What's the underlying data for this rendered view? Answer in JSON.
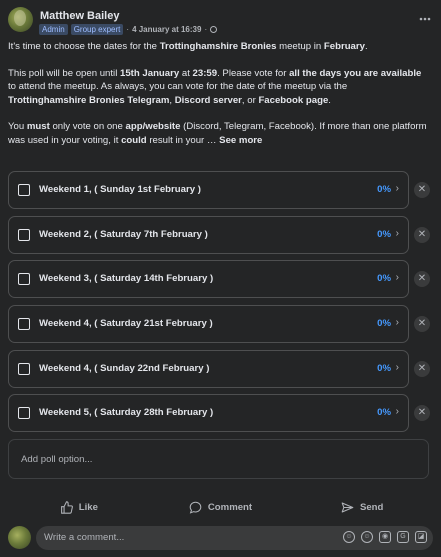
{
  "post": {
    "author": "Matthew Bailey",
    "badges": [
      "Admin",
      "Group expert"
    ],
    "separator": "·",
    "date": "4 January at 16:39",
    "more_icon": "more-horizontal-icon",
    "privacy_icon": "globe-icon"
  },
  "body": {
    "p1": [
      {
        "t": "It's time to choose the dates for the "
      },
      {
        "t": "Trottinghamshire Bronies",
        "b": true
      },
      {
        "t": " meetup in "
      },
      {
        "t": "February",
        "b": true
      },
      {
        "t": "."
      }
    ],
    "p2": [
      {
        "t": "This poll will be open until "
      },
      {
        "t": "15th January",
        "b": true
      },
      {
        "t": " at "
      },
      {
        "t": "23:59",
        "b": true
      },
      {
        "t": ". Please vote for "
      },
      {
        "t": "all the days you are available",
        "b": true
      },
      {
        "t": " to attend the meetup. As always, you can vote for the date of the meetup via the "
      },
      {
        "t": "Trottinghamshire Bronies Telegram",
        "b": true
      },
      {
        "t": ", "
      },
      {
        "t": "Discord server",
        "b": true
      },
      {
        "t": ", or "
      },
      {
        "t": "Facebook page",
        "b": true
      },
      {
        "t": "."
      }
    ],
    "p3": [
      {
        "t": "You "
      },
      {
        "t": "must",
        "b": true
      },
      {
        "t": " only vote on one "
      },
      {
        "t": "app/website",
        "b": true
      },
      {
        "t": " (Discord, Telegram, Facebook). If more than one platform was used in your voting, it "
      },
      {
        "t": "could",
        "b": true
      },
      {
        "t": " result in your … "
      }
    ],
    "see_more": "See more"
  },
  "poll": {
    "options": [
      {
        "label": "Weekend 1, ( Sunday 1st February )",
        "percent": "0%"
      },
      {
        "label": "Weekend 2, ( Saturday 7th February )",
        "percent": "0%"
      },
      {
        "label": "Weekend 3, ( Saturday 14th February )",
        "percent": "0%"
      },
      {
        "label": "Weekend 4, ( Saturday 21st February )",
        "percent": "0%"
      },
      {
        "label": "Weekend 4, ( Sunday 22nd February )",
        "percent": "0%"
      },
      {
        "label": "Weekend 5, ( Saturday 28th February )",
        "percent": "0%"
      }
    ],
    "add_option_placeholder": "Add poll option..."
  },
  "actions": {
    "like": "Like",
    "comment": "Comment",
    "send": "Send"
  },
  "comment": {
    "placeholder": "Write a comment..."
  },
  "colors": {
    "background": "#242526",
    "accent": "#4599ff",
    "text": "#e4e6eb",
    "muted": "#b0b3b8"
  }
}
